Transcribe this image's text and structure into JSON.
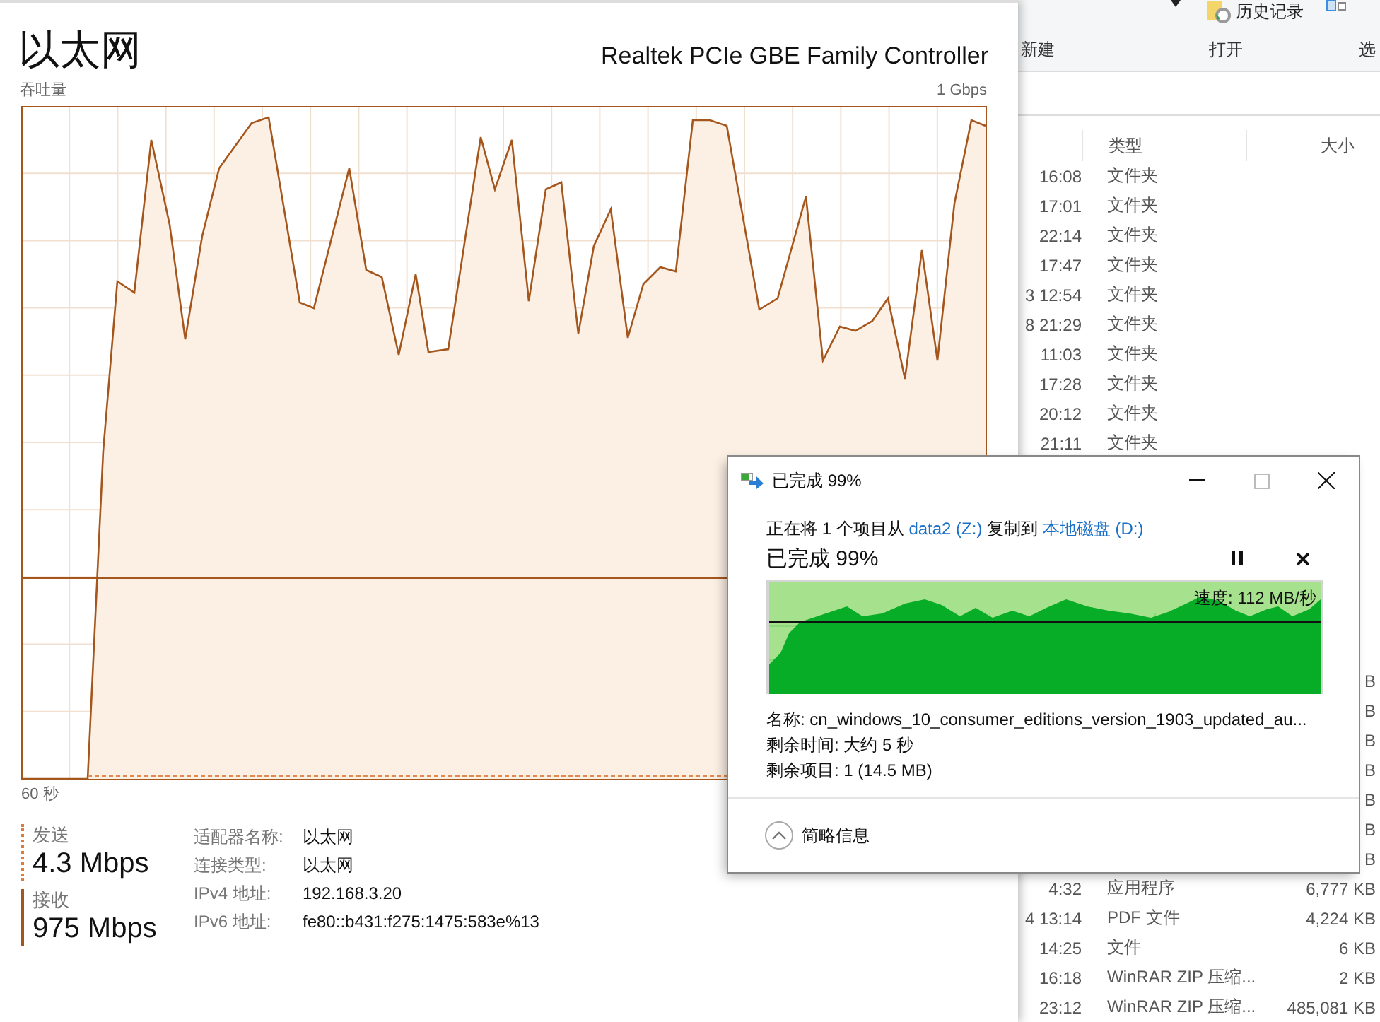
{
  "task_manager": {
    "title": "以太网",
    "adapter": "Realtek PCIe GBE Family Controller",
    "graph_label": "吞吐量",
    "graph_max": "1 Gbps",
    "graph_span": "60 秒",
    "meters": [
      {
        "kind": "send",
        "label": "发送",
        "value": "4.3 Mbps"
      },
      {
        "kind": "receive",
        "label": "接收",
        "value": "975 Mbps"
      }
    ],
    "details": [
      {
        "label": "适配器名称:",
        "value": "以太网"
      },
      {
        "label": "连接类型:",
        "value": "以太网"
      },
      {
        "label": "IPv4 地址:",
        "value": "192.168.3.20"
      },
      {
        "label": "IPv6 地址:",
        "value": "fe80::b431:f275:1475:583e%13"
      }
    ]
  },
  "explorer": {
    "ribbon_item": "历史记录",
    "groups": [
      "新建",
      "打开",
      "选"
    ],
    "columns": [
      "类型",
      "大小"
    ],
    "rows_top": [
      {
        "time": "16:08",
        "type": "文件夹"
      },
      {
        "time": "17:01",
        "type": "文件夹"
      },
      {
        "time": "22:14",
        "type": "文件夹"
      },
      {
        "time": "17:47",
        "type": "文件夹"
      },
      {
        "time": "3 12:54",
        "type": "文件夹"
      },
      {
        "time": "8 21:29",
        "type": "文件夹"
      },
      {
        "time": "11:03",
        "type": "文件夹"
      },
      {
        "time": "17:28",
        "type": "文件夹"
      },
      {
        "time": "20:12",
        "type": "文件夹"
      },
      {
        "time": "21:11",
        "type": "文件夹"
      }
    ],
    "rows_bottom": [
      {
        "size": "B"
      },
      {
        "size": "B"
      },
      {
        "size": "B"
      },
      {
        "size": "B"
      },
      {
        "size": "B"
      },
      {
        "size": "B"
      },
      {
        "size": "B"
      },
      {
        "time": "4:32",
        "type": "应用程序",
        "size": "6,777 KB"
      },
      {
        "time": "4 13:14",
        "type": "PDF 文件",
        "size": "4,224 KB"
      },
      {
        "time": "14:25",
        "type": "文件",
        "size": "6 KB"
      },
      {
        "time": "16:18",
        "type": "WinRAR ZIP 压缩...",
        "size": "2 KB"
      },
      {
        "time": "23:12",
        "type": "WinRAR ZIP 压缩...",
        "size": "485,081 KB"
      }
    ]
  },
  "dialog": {
    "title": "已完成 99%",
    "line_prefix": "正在将 1 个项目从",
    "source": "data2 (Z:)",
    "line_middle": "复制到",
    "destination": "本地磁盘 (D:)",
    "progress_title": "已完成 99%",
    "speed": "速度: 112 MB/秒",
    "details": [
      "名称: cn_windows_10_consumer_editions_version_1903_updated_au...",
      "剩余时间: 大约 5 秒",
      "剩余项目: 1 (14.5 MB)"
    ],
    "footer": "简略信息"
  }
}
